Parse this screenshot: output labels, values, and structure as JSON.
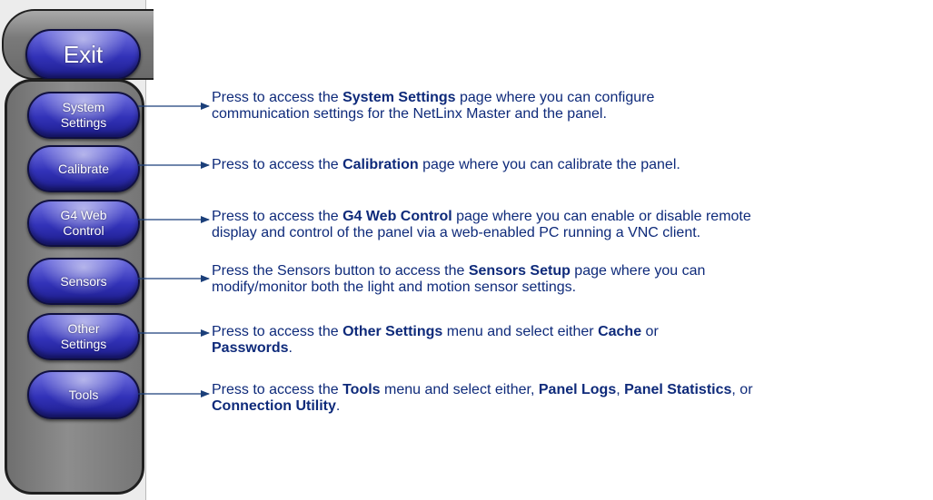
{
  "exit_button": {
    "label": "Exit"
  },
  "menu": [
    {
      "id": "system-settings",
      "lines": [
        "System",
        "Settings"
      ]
    },
    {
      "id": "calibrate",
      "lines": [
        "Calibrate"
      ]
    },
    {
      "id": "g4-web-control",
      "lines": [
        "G4 Web",
        "Control"
      ]
    },
    {
      "id": "sensors",
      "lines": [
        "Sensors"
      ]
    },
    {
      "id": "other-settings",
      "lines": [
        "Other",
        "Settings"
      ]
    },
    {
      "id": "tools",
      "lines": [
        "Tools"
      ]
    }
  ],
  "callouts": [
    {
      "id": "system-settings",
      "lines": [
        [
          {
            "t": "Press to access the "
          },
          {
            "t": "System Settings",
            "b": true
          },
          {
            "t": " page where you can configure"
          }
        ],
        [
          {
            "t": "communication settings for the NetLinx Master and the panel."
          }
        ]
      ]
    },
    {
      "id": "calibrate",
      "lines": [
        [
          {
            "t": "Press to access the "
          },
          {
            "t": "Calibration",
            "b": true
          },
          {
            "t": " page where you can calibrate the panel."
          }
        ]
      ]
    },
    {
      "id": "g4-web-control",
      "lines": [
        [
          {
            "t": "Press to access the "
          },
          {
            "t": "G4 Web Control",
            "b": true
          },
          {
            "t": " page where you can enable or disable remote"
          }
        ],
        [
          {
            "t": "display and control of the panel via a web-enabled PC running a VNC client."
          }
        ]
      ]
    },
    {
      "id": "sensors",
      "lines": [
        [
          {
            "t": "Press the Sensors button to access the "
          },
          {
            "t": "Sensors Setup",
            "b": true
          },
          {
            "t": " page where you can"
          }
        ],
        [
          {
            "t": "modify/monitor both the light and motion sensor settings."
          }
        ]
      ]
    },
    {
      "id": "other-settings",
      "lines": [
        [
          {
            "t": "Press to access the "
          },
          {
            "t": "Other Settings",
            "b": true
          },
          {
            "t": " menu and select either "
          },
          {
            "t": "Cache",
            "b": true
          },
          {
            "t": " or"
          }
        ],
        [
          {
            "t": "Passwords",
            "b": true
          },
          {
            "t": "."
          }
        ]
      ]
    },
    {
      "id": "tools",
      "lines": [
        [
          {
            "t": "Press to access the "
          },
          {
            "t": "Tools",
            "b": true
          },
          {
            "t": " menu and select either, "
          },
          {
            "t": "Panel Logs",
            "b": true
          },
          {
            "t": ", "
          },
          {
            "t": "Panel Statistics",
            "b": true
          },
          {
            "t": ", or"
          }
        ],
        [
          {
            "t": "Connection Utility",
            "b": true
          },
          {
            "t": "."
          }
        ]
      ]
    }
  ],
  "colors": {
    "button_blue": "#3232b8",
    "callout_text": "#0e2a7a",
    "arrow": "#1b3f7a"
  }
}
